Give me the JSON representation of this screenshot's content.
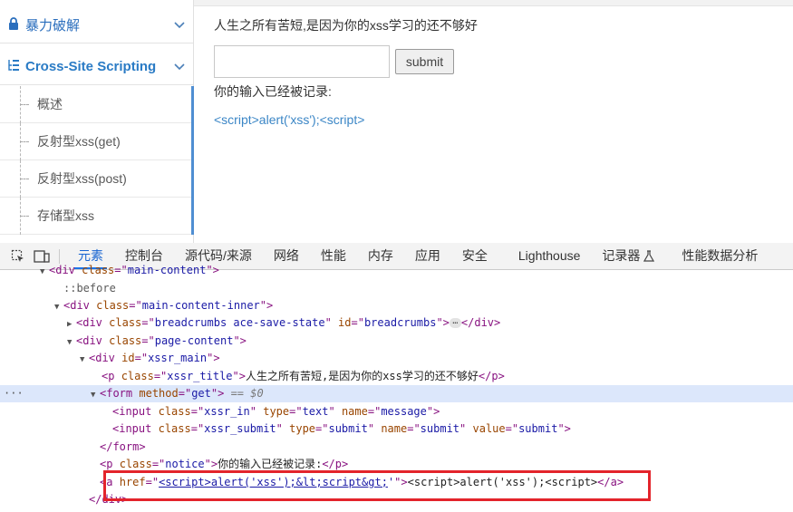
{
  "sidebar": {
    "brute": {
      "label": "暴力破解",
      "icon": "lock-icon"
    },
    "xss": {
      "label": "Cross-Site Scripting",
      "icon": "tree-list-icon"
    },
    "children": [
      {
        "label": "概述"
      },
      {
        "label": "反射型xss(get)"
      },
      {
        "label": "反射型xss(post)"
      },
      {
        "label": "存储型xss"
      }
    ]
  },
  "main": {
    "title": "人生之所有苦短,是因为你的xss学习的还不够好",
    "input_value": "",
    "submit_label": "submit",
    "notice": "你的输入已经被记录:",
    "link_text": "<script>alert('xss');<script>"
  },
  "devtools": {
    "tabs": [
      "元素",
      "控制台",
      "源代码/来源",
      "网络",
      "性能",
      "内存",
      "应用",
      "安全",
      "Lighthouse",
      "记录器",
      "性能数据分析"
    ],
    "active_tab": "元素",
    "colors": {
      "tag": "#881280",
      "attr_name": "#994500",
      "attr_value": "#1a1aa6",
      "highlight": "#e3242b",
      "selected_row": "#dce7fb"
    },
    "tree": {
      "l0": {
        "tag": "div",
        "attr": "class",
        "val": "main-content"
      },
      "l1": "::before",
      "l2": {
        "tag": "div",
        "attr": "class",
        "val": "main-content-inner"
      },
      "l3": {
        "tag": "div",
        "attr": "class",
        "val": "breadcrumbs ace-save-state",
        "attr2": "id",
        "val2": "breadcrumbs",
        "close": "</div>"
      },
      "l4": {
        "tag": "div",
        "attr": "class",
        "val": "page-content"
      },
      "l5": {
        "tag": "div",
        "attr": "id",
        "val": "xssr_main"
      },
      "l6": {
        "tag": "p",
        "attr": "class",
        "val": "xssr_title",
        "text": "人生之所有苦短,是因为你的xss学习的还不够好",
        "close": "</p>"
      },
      "l7": {
        "tag": "form",
        "attr": "method",
        "val": "get",
        "suffix": "== $0"
      },
      "l8": {
        "tag": "input",
        "a1": "class",
        "v1": "xssr_in",
        "a2": "type",
        "v2": "text",
        "a3": "name",
        "v3": "message"
      },
      "l9": {
        "tag": "input",
        "a1": "class",
        "v1": "xssr_submit",
        "a2": "type",
        "v2": "submit",
        "a3": "name",
        "v3": "submit",
        "a4": "value",
        "v4": "submit"
      },
      "l10": "</form>",
      "l11": {
        "tag": "p",
        "attr": "class",
        "val": "notice",
        "text": "你的输入已经被记录:",
        "close": "</p>"
      },
      "l12": {
        "tag": "a",
        "attr": "href",
        "val_link": "<script>alert('xss');&lt;script&gt;",
        "val_rest": "'",
        "text": "<script>alert('xss');<script>",
        "close": "</a>"
      },
      "l13": "</div>"
    }
  }
}
